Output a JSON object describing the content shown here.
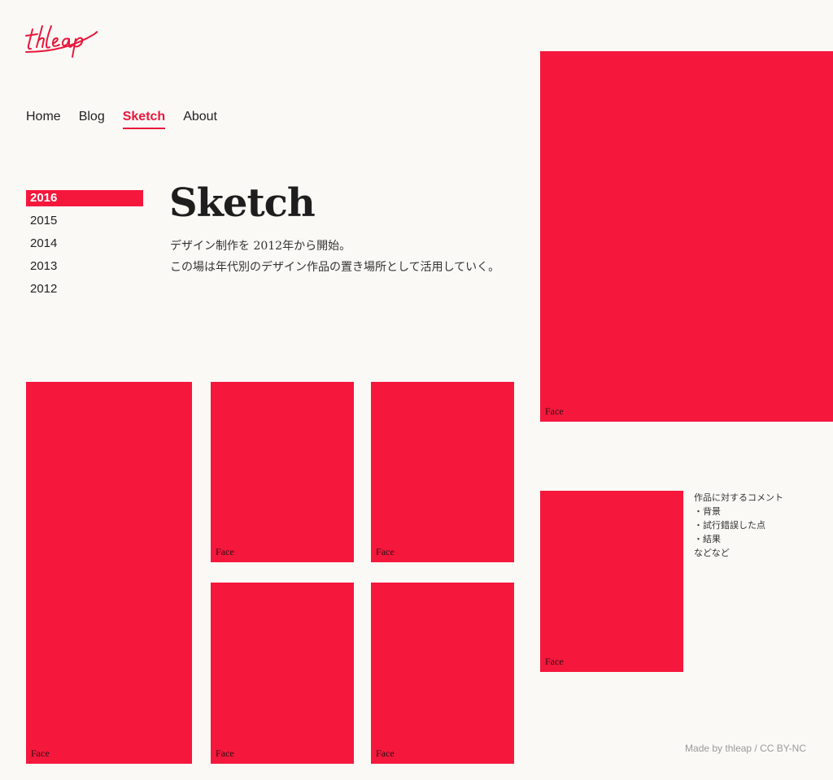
{
  "brand": {
    "logo_text": "thleap",
    "accent_color": "#f5173c"
  },
  "nav": {
    "items": [
      {
        "label": "Home"
      },
      {
        "label": "Blog"
      },
      {
        "label": "Sketch",
        "active": true
      },
      {
        "label": "About"
      }
    ]
  },
  "years": [
    {
      "label": "2016",
      "active": true
    },
    {
      "label": "2015"
    },
    {
      "label": "2014"
    },
    {
      "label": "2013"
    },
    {
      "label": "2012"
    }
  ],
  "page": {
    "title": "Sketch",
    "description_line1": "デザイン制作を 2012年から開始。",
    "description_line2": "この場は年代別のデザイン作品の置き場所として活用していく。"
  },
  "gallery": {
    "tiles": [
      {
        "label": "Face"
      },
      {
        "label": "Face"
      },
      {
        "label": "Face"
      },
      {
        "label": "Face"
      },
      {
        "label": "Face"
      },
      {
        "label": "Face"
      },
      {
        "label": "Face"
      }
    ]
  },
  "comment": {
    "lines": [
      "作品に対するコメント",
      "・背景",
      "・試行錯誤した点",
      "・結果",
      "などなど"
    ]
  },
  "footer": {
    "text": "Made by  thleap / CC BY-NC"
  }
}
